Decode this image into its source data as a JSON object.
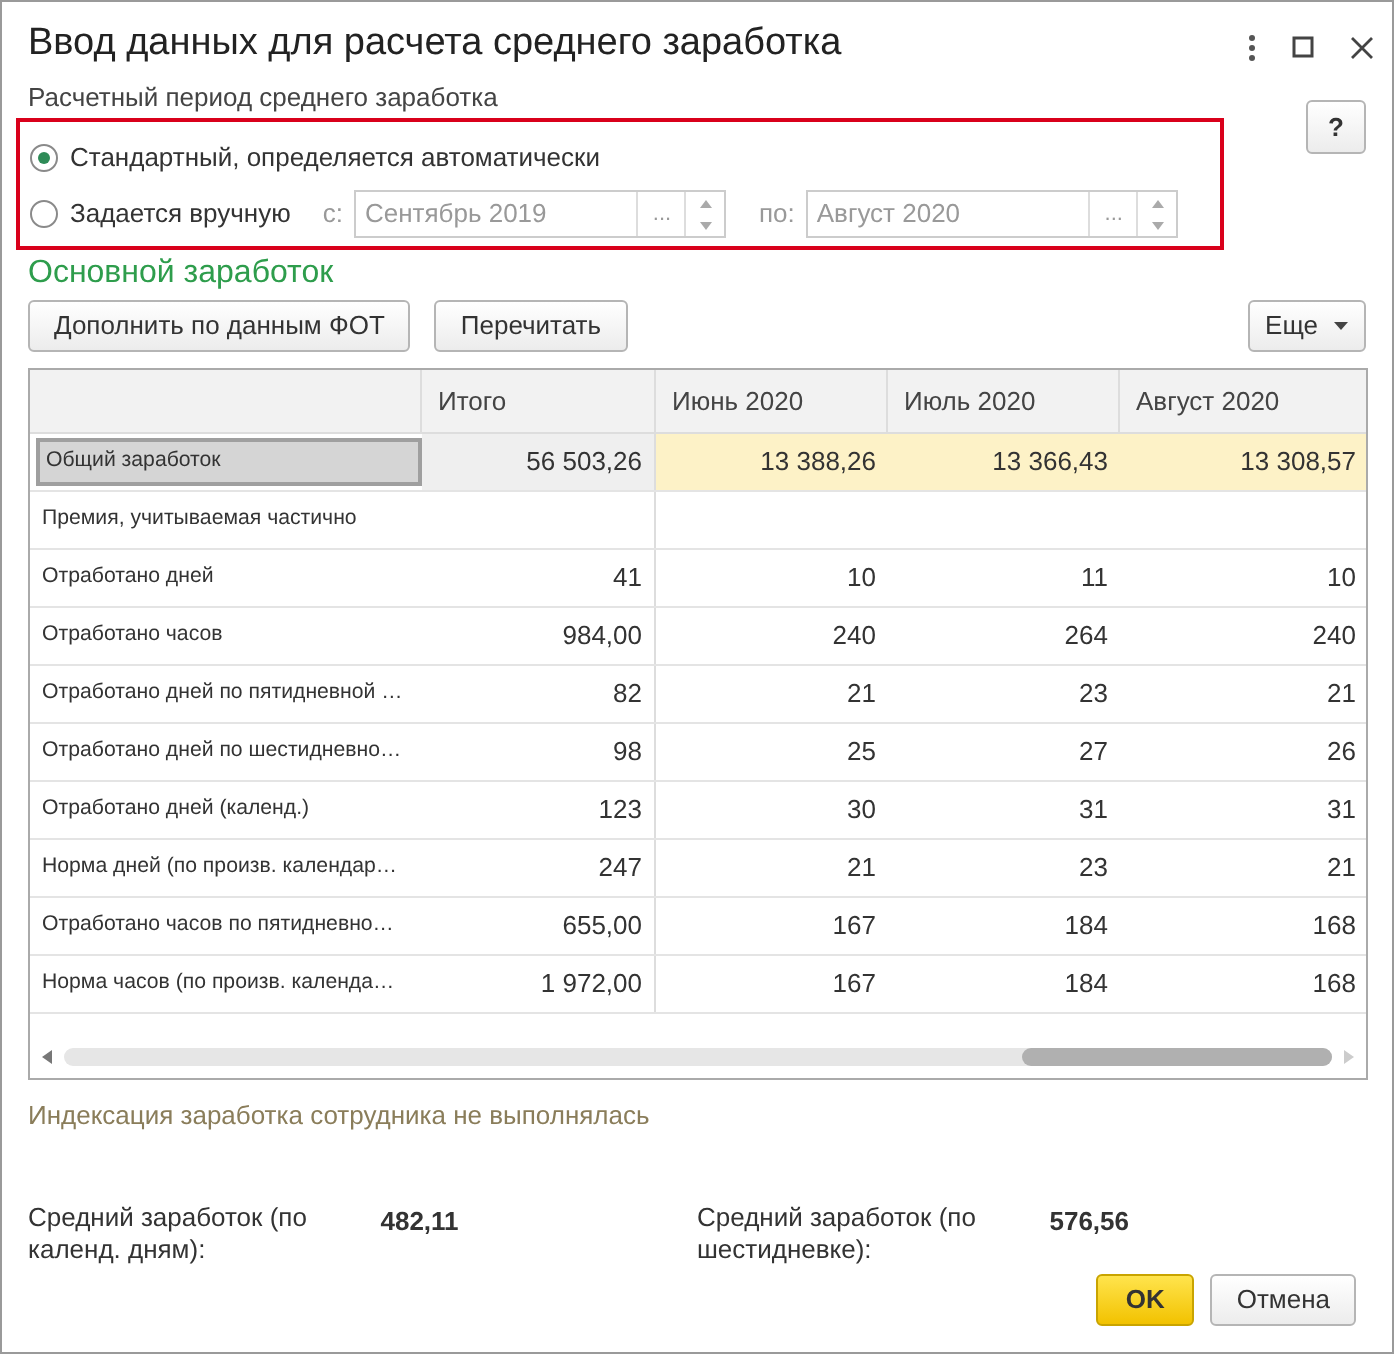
{
  "window": {
    "title": "Ввод данных для расчета среднего заработка"
  },
  "period": {
    "label": "Расчетный период среднего заработка",
    "options": [
      {
        "label": "Стандартный, определяется автоматически",
        "selected": true
      },
      {
        "label": "Задается вручную",
        "selected": false
      }
    ],
    "fields": [
      {
        "label": "с:",
        "value": "Сентябрь 2019",
        "disabled": true,
        "button": "..."
      },
      {
        "label": "по:",
        "value": "Август 2020",
        "disabled": true,
        "button": "..."
      }
    ]
  },
  "help_button": "?",
  "section_title": "Основной заработок",
  "toolbar": {
    "buttons": [
      "Дополнить по данным ФОТ",
      "Перечитать"
    ],
    "more": "Еще"
  },
  "table": {
    "columns": [
      "Итого",
      "Июнь 2020",
      "Июль 2020",
      "Август 2020"
    ],
    "rows": [
      {
        "kind": "sum",
        "name": "Общий заработок",
        "selected": true,
        "cells": [
          "56 503,26",
          "13 388,26",
          "13 366,43",
          "13 308,57"
        ]
      },
      {
        "kind": "line",
        "name": "Премия, учитываемая частично",
        "selected": false,
        "cells": []
      },
      {
        "kind": "line",
        "name": "Отработано дней",
        "selected": false,
        "cells": [
          "41",
          "10",
          "11",
          "10"
        ]
      },
      {
        "kind": "line",
        "name": "Отработано часов",
        "selected": false,
        "cells": [
          "984,00",
          "240",
          "264",
          "240"
        ]
      },
      {
        "kind": "line",
        "name": "Отработано дней по пятидневной …",
        "selected": false,
        "cells": [
          "82",
          "21",
          "23",
          "21"
        ]
      },
      {
        "kind": "line",
        "name": "Отработано дней по шестидневно…",
        "selected": false,
        "cells": [
          "98",
          "25",
          "27",
          "26"
        ]
      },
      {
        "kind": "line",
        "name": "Отработано дней (календ.)",
        "selected": false,
        "cells": [
          "123",
          "30",
          "31",
          "31"
        ]
      },
      {
        "kind": "line",
        "name": "Норма дней (по произв. календар…",
        "selected": false,
        "cells": [
          "247",
          "21",
          "23",
          "21"
        ]
      },
      {
        "kind": "line",
        "name": "Отработано часов по пятидневно…",
        "selected": false,
        "cells": [
          "655,00",
          "167",
          "184",
          "168"
        ]
      },
      {
        "kind": "line",
        "name": "Норма часов (по произв. календа…",
        "selected": false,
        "cells": [
          "1 972,00",
          "167",
          "184",
          "168"
        ]
      }
    ]
  },
  "indexation_note": "Индексация заработка сотрудника не выполнялась",
  "averages": [
    {
      "label": "Средний заработок (по календ. дням):",
      "value": "482,11"
    },
    {
      "label": "Средний заработок (по шестидневке):",
      "value": "576,56"
    }
  ],
  "buttons": [
    {
      "label": "OK",
      "kind": "primary"
    },
    {
      "label": "Отмена",
      "kind": "secondary"
    }
  ]
}
